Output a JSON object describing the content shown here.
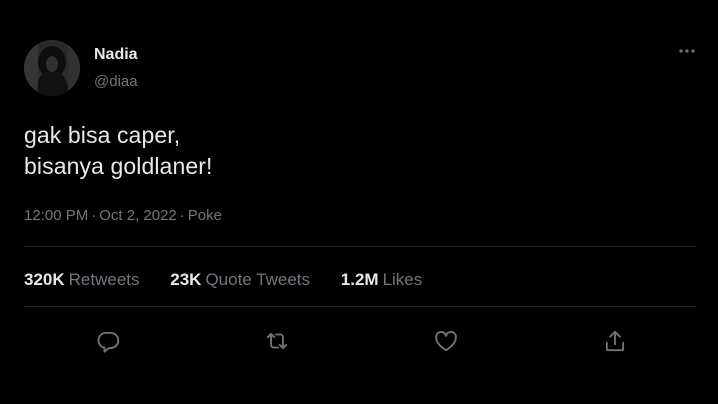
{
  "user": {
    "display_name": "Nadia",
    "handle": "@diaa",
    "avatar_icon": "profile-photo"
  },
  "tweet": {
    "text": "gak bisa caper,\nbisanya goldlaner!",
    "time": "12:00 PM",
    "date": "Oct 2, 2022",
    "source": "Poke",
    "separator": "·"
  },
  "stats": {
    "retweets_count": "320K",
    "retweets_label": "Retweets",
    "quotes_count": "23K",
    "quotes_label": "Quote Tweets",
    "likes_count": "1.2M",
    "likes_label": "Likes"
  },
  "actions": {
    "reply_icon": "reply-icon",
    "retweet_icon": "retweet-icon",
    "like_icon": "heart-icon",
    "share_icon": "share-icon",
    "more_icon": "more-dots-icon"
  },
  "colors": {
    "background": "#000000",
    "primary_text": "#e7e9ea",
    "secondary_text": "#71767b",
    "divider": "#202327"
  }
}
